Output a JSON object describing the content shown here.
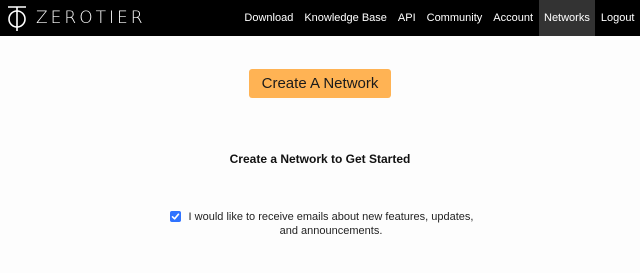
{
  "brand": {
    "name": "ZEROTIER",
    "icon": "zerotier-logo-icon"
  },
  "nav": {
    "items": [
      {
        "label": "Download",
        "active": false
      },
      {
        "label": "Knowledge Base",
        "active": false
      },
      {
        "label": "API",
        "active": false
      },
      {
        "label": "Community",
        "active": false
      },
      {
        "label": "Account",
        "active": false
      },
      {
        "label": "Networks",
        "active": true
      },
      {
        "label": "Logout",
        "active": false
      }
    ]
  },
  "main": {
    "create_button_label": "Create A Network",
    "headline": "Create a Network to Get Started",
    "email_optin": {
      "checked": true,
      "label": "I would like to receive emails about new features, updates, and announcements."
    }
  },
  "colors": {
    "topbar": "#000000",
    "nav_active": "#333333",
    "button": "#ffb354",
    "checkbox": "#2f73ff",
    "page_background": "#fdfdfd"
  }
}
